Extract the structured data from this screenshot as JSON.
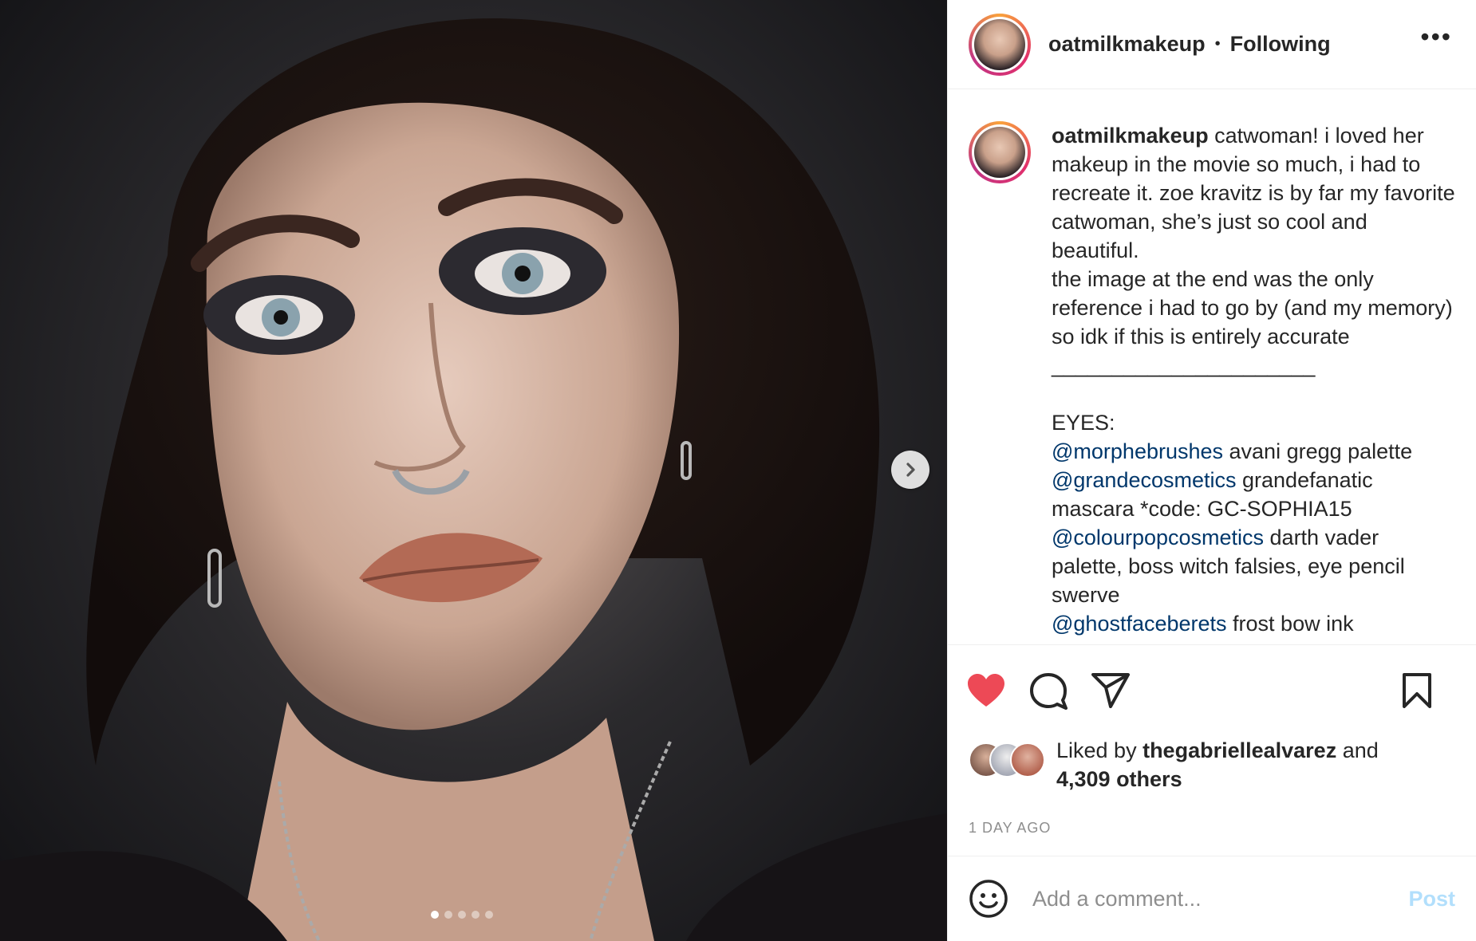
{
  "media": {
    "slide_count": 5,
    "active_slide": 1,
    "next_icon": "chevron-right-icon"
  },
  "header": {
    "username": "oatmilkmakeup",
    "separator": "•",
    "follow_status": "Following",
    "more_icon": "more-options-icon",
    "more_label": "•••"
  },
  "caption": {
    "username": "oatmilkmakeup",
    "intro": " catwoman! i loved her makeup in the movie so much, i had to recreate it. zoe kravitz is by far my favorite catwoman, she’s just so cool and beautiful.\nthe image at the end was the only reference i had to go by (and my memory) so idk if this is entirely accurate\n______________________\n\nEYES:\n",
    "mention_1": "@morphebrushes",
    "text_1": " avani gregg palette\n",
    "mention_2": "@grandecosmetics",
    "text_2": " grandefanatic mascara *code: GC-SOPHIA15\n",
    "mention_3": "@colourpopcosmetics",
    "text_3": " darth vader palette, boss witch falsies, eye pencil swerve\n",
    "mention_4": "@ghostfaceberets",
    "text_4": " frost bow ink"
  },
  "actions": {
    "like_icon": "heart-filled-icon",
    "comment_icon": "comment-icon",
    "share_icon": "share-icon",
    "save_icon": "bookmark-icon",
    "like_color": "#ed4956"
  },
  "likes": {
    "prefix": "Liked by ",
    "user": "thegabriellealvarez",
    "middle": " and",
    "others": "4,309 others"
  },
  "timestamp": "1 DAY AGO",
  "comment": {
    "placeholder": "Add a comment...",
    "post_label": "Post",
    "emoji_icon": "emoji-icon"
  }
}
